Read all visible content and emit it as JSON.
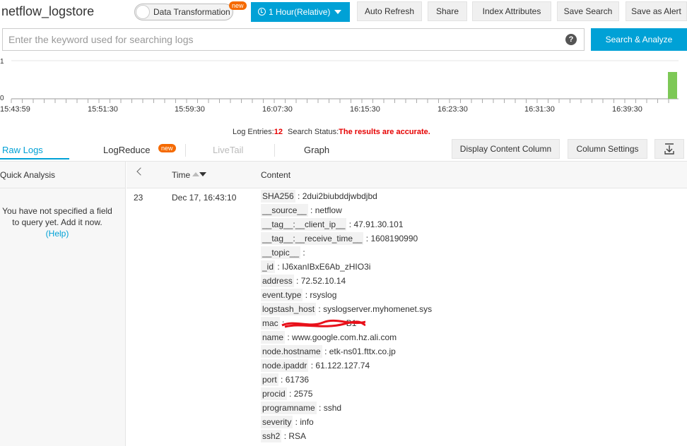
{
  "logstore": "netflow_logstore",
  "toolbar": {
    "data_transformation": "Data Transformation",
    "new_badge": "new",
    "time_range": "1 Hour(Relative)",
    "auto_refresh": "Auto Refresh",
    "share": "Share",
    "index_attributes": "Index Attributes",
    "save_search": "Save Search",
    "save_as_alert": "Save as Alert"
  },
  "search": {
    "placeholder": "Enter the keyword used for searching logs",
    "help_icon": "question-icon",
    "button": "Search & Analyze"
  },
  "histogram": {
    "y_labels": [
      "1",
      "0"
    ],
    "tick_labels": [
      "15:43:59",
      "15:51:30",
      "15:59:30",
      "16:07:30",
      "16:15:30",
      "16:23:30",
      "16:31:30",
      "16:39:30"
    ],
    "bar_color": "#7dc856",
    "last_bar_fraction": 1.0
  },
  "status": {
    "entries_label": "Log Entries:",
    "entries_value": "12",
    "search_label": "Search Status:",
    "search_value": "The results are accurate."
  },
  "tabs": {
    "raw_logs": "Raw Logs",
    "logreduce": "LogReduce",
    "logreduce_badge": "new",
    "livetail": "LiveTail",
    "graph": "Graph",
    "display_content_column": "Display Content Column",
    "column_settings": "Column Settings",
    "download_icon": "download-icon"
  },
  "quick_analysis": {
    "title": "Quick Analysis",
    "message": "You have not specified a field to query yet. Add it now.",
    "help_link": "(Help)"
  },
  "table": {
    "time_header": "Time",
    "content_header": "Content",
    "row": {
      "index": "23",
      "time": "Dec 17, 16:43:10",
      "fields": [
        {
          "key": "SHA256",
          "value": "2dui2biubddjwbdjbd"
        },
        {
          "key": "__source__",
          "value": "netflow"
        },
        {
          "key": "__tag__:__client_ip__",
          "value": "47.91.30.101"
        },
        {
          "key": "__tag__:__receive_time__",
          "value": "1608190990"
        },
        {
          "key": "__topic__",
          "value": ""
        },
        {
          "key": "_id",
          "value": "IJ6xanIBxE6Ab_zHIO3i"
        },
        {
          "key": "address",
          "value": "72.52.10.14"
        },
        {
          "key": "event.type",
          "value": "rsyslog"
        },
        {
          "key": "logstash_host",
          "value": "syslogserver.myhomenet.sys"
        },
        {
          "key": "mac",
          "value": "B1"
        },
        {
          "key": "name",
          "value": "www.google.com.hz.ali.com"
        },
        {
          "key": "node.hostname",
          "value": "etk-ns01.fttx.co.jp"
        },
        {
          "key": "node.ipaddr",
          "value": "61.122.127.74"
        },
        {
          "key": "port",
          "value": "61736"
        },
        {
          "key": "procid",
          "value": "2575"
        },
        {
          "key": "programname",
          "value": "sshd"
        },
        {
          "key": "severity",
          "value": "info"
        },
        {
          "key": "ssh2",
          "value": "RSA"
        }
      ]
    }
  }
}
